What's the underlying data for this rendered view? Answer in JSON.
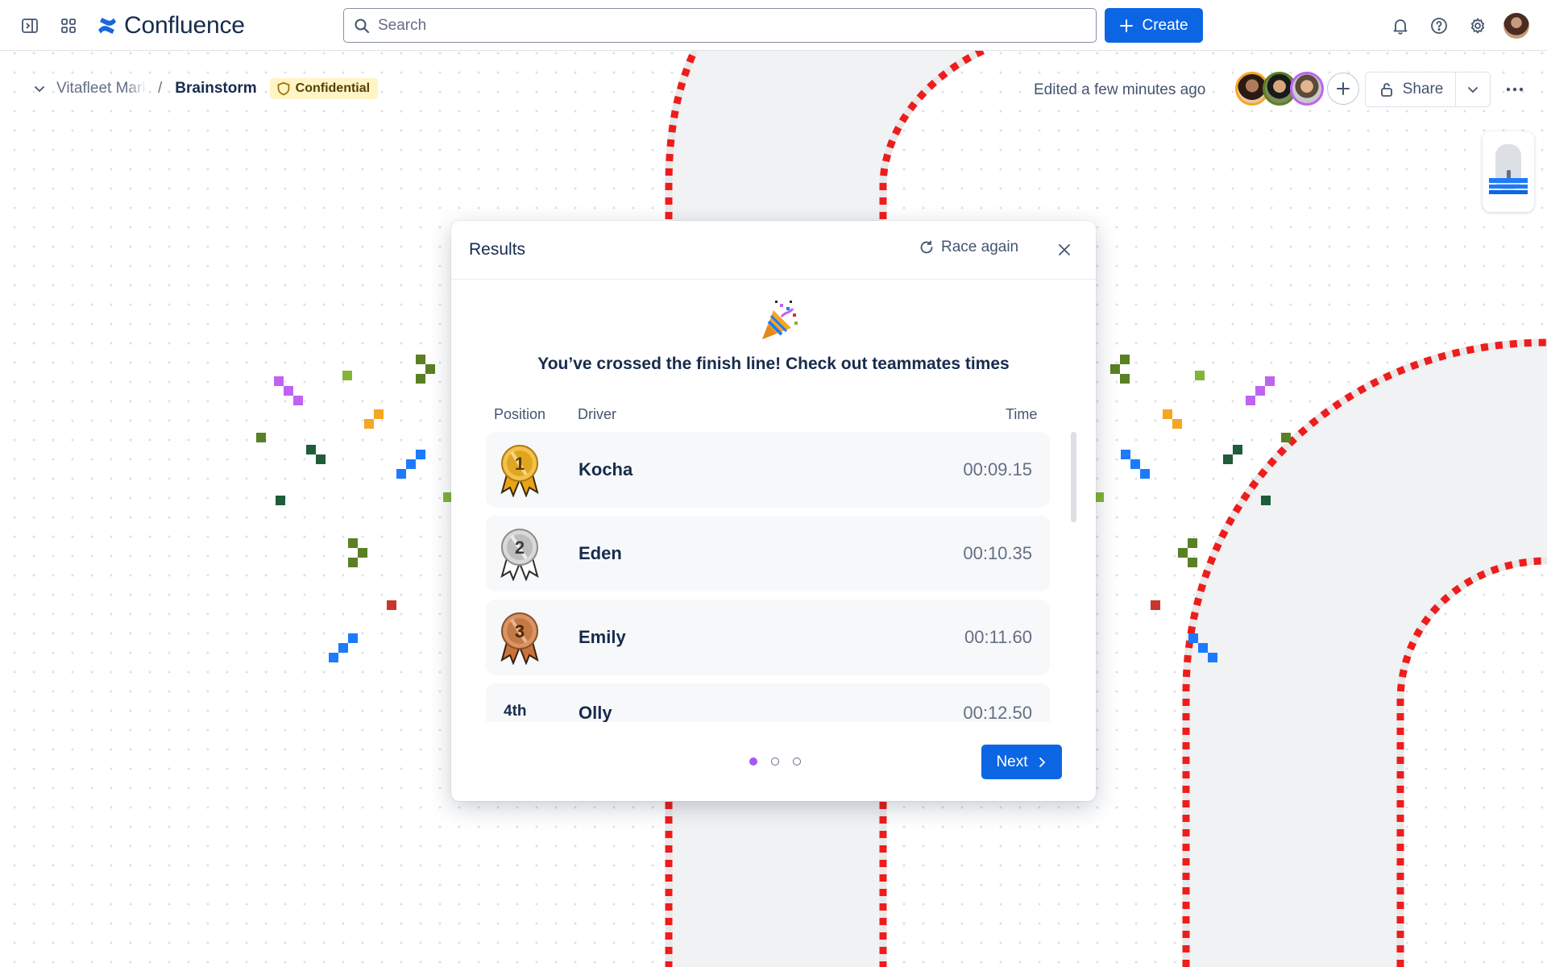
{
  "app": {
    "name": "Confluence"
  },
  "nav": {
    "search_placeholder": "Search",
    "create_label": "Create"
  },
  "page": {
    "breadcrumb_parent": "Vitafleet Marketing",
    "breadcrumb_separator": "/",
    "title": "Brainstorm",
    "classification": "Confidential",
    "edited_status": "Edited a few minutes ago",
    "share_label": "Share"
  },
  "modal": {
    "title": "Results",
    "race_again_label": "Race again",
    "headline": "You’ve crossed the finish line! Check out teammates times",
    "columns": {
      "position": "Position",
      "driver": "Driver",
      "time": "Time"
    },
    "rows": [
      {
        "position": "1",
        "medal": "gold-medal-icon",
        "driver": "Kocha",
        "time": "00:09.15"
      },
      {
        "position": "2",
        "medal": "silver-medal-icon",
        "driver": "Eden",
        "time": "00:10.35"
      },
      {
        "position": "3",
        "medal": "bronze-medal-icon",
        "driver": "Emily",
        "time": "00:11.60"
      },
      {
        "position": "4th",
        "driver": "Olly",
        "time": "00:12.50"
      }
    ],
    "pagination": {
      "current": 1,
      "total": 3
    },
    "next_label": "Next"
  },
  "colors": {
    "brand_blue": "#0c66e4",
    "track_red": "#ee1c1c",
    "lozenge_bg": "#fff4c4",
    "active_dot": "#a855f7"
  }
}
